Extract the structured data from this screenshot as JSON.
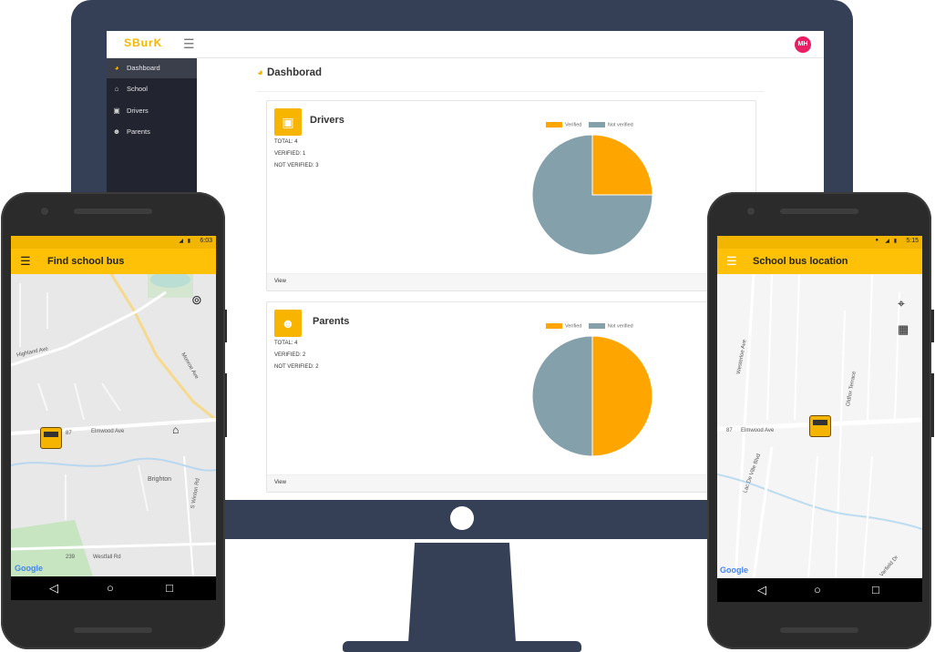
{
  "desktop": {
    "brand": "SBurK",
    "avatar_initials": "MH",
    "sidebar": {
      "items": [
        {
          "label": "Dashboard",
          "icon": "gauge-icon",
          "active": true
        },
        {
          "label": "School",
          "icon": "school-icon",
          "active": false
        },
        {
          "label": "Drivers",
          "icon": "bus-icon",
          "active": false
        },
        {
          "label": "Parents",
          "icon": "users-icon",
          "active": false
        }
      ]
    },
    "page_title": "Dashborad",
    "cards": [
      {
        "title": "Drivers",
        "icon": "bus-icon",
        "total": "TOTAL: 4",
        "verified": "VERIFIED: 1",
        "not_verified": "NOT VERIFIED: 3",
        "footer": "View",
        "legend": [
          "Verified",
          "Not verified"
        ]
      },
      {
        "title": "Parents",
        "icon": "users-icon",
        "total": "TOTAL: 4",
        "verified": "VERIFIED: 2",
        "not_verified": "NOT VERIFIED: 2",
        "footer": "View",
        "legend": [
          "Verified",
          "Not verified"
        ]
      }
    ],
    "colors": {
      "accent": "#f7b500",
      "verified": "#ffa500",
      "not_verified": "#84a1ab",
      "sidebar": "#222430"
    }
  },
  "chart_data": [
    {
      "type": "pie",
      "categories": [
        "Verified",
        "Not verified"
      ],
      "values": [
        1,
        3
      ],
      "title": "",
      "legend": "top"
    },
    {
      "type": "pie",
      "categories": [
        "Verified",
        "Not verified"
      ],
      "values": [
        2,
        2
      ],
      "title": "",
      "legend": "top"
    }
  ],
  "phone_left": {
    "time": "6:03",
    "title": "Find school bus",
    "map_labels": [
      "Highland Ave",
      "Elmwood Ave",
      "87",
      "Brighton",
      "239",
      "Westfall Rd",
      "Monroe Ave",
      "S Winton Rd"
    ],
    "google": "Google"
  },
  "phone_right": {
    "time": "5:15",
    "title": "School bus location",
    "map_labels": [
      "Elmwood Ave",
      "87",
      "Westerloe Ave",
      "Oldfox Terrace",
      "Lac De Ville Blvd",
      "Varfield Dr"
    ],
    "google": "Google"
  }
}
